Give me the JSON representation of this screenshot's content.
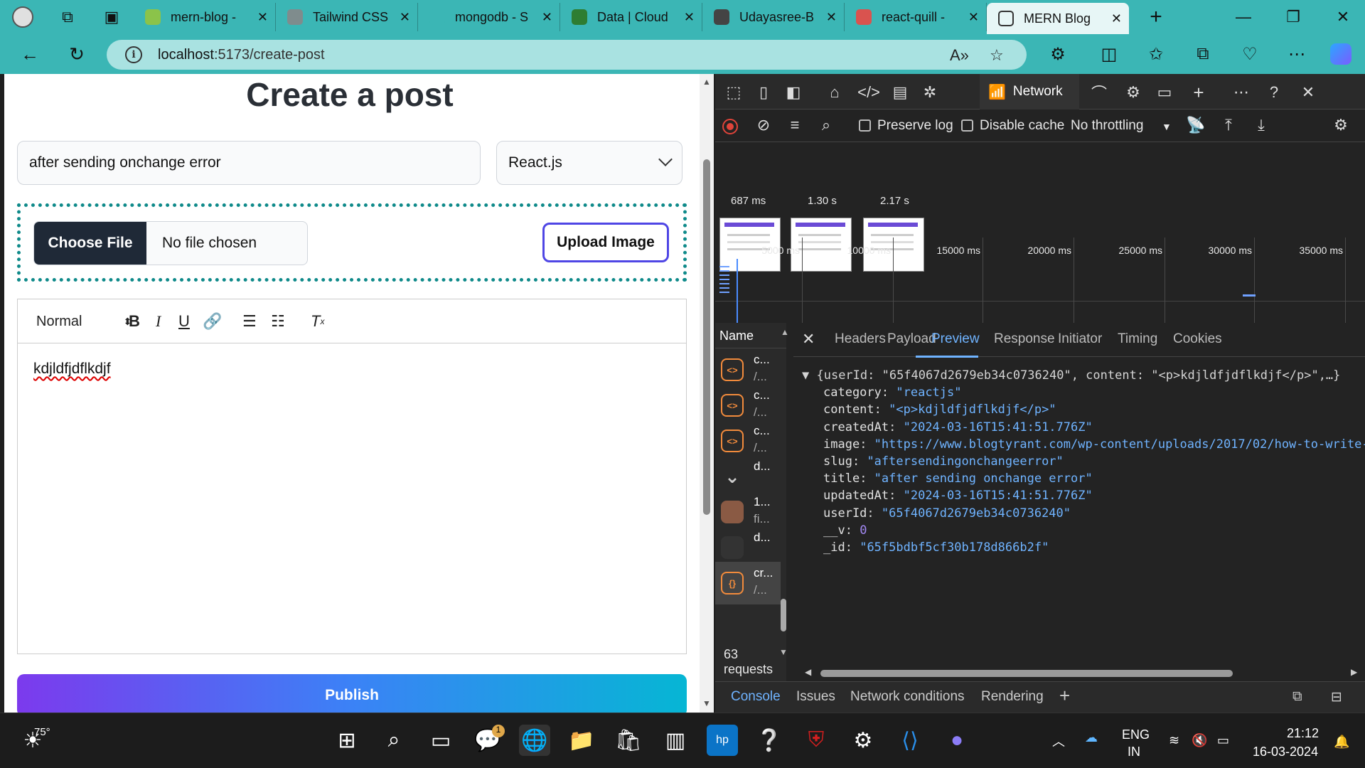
{
  "browser": {
    "tabs": [
      {
        "label": "mern-blog -",
        "color": "#8bc34a"
      },
      {
        "label": "Tailwind CSS",
        "color": "#7f8c8d"
      },
      {
        "label": "mongodb - S",
        "color": "#3bb6b5"
      },
      {
        "label": "Data | Cloud",
        "color": "#2e7d32"
      },
      {
        "label": "Udayasree-B",
        "color": "#444444"
      },
      {
        "label": "react-quill -",
        "color": "#d9534f"
      },
      {
        "label": "MERN Blog",
        "color": "#e7f6f6"
      }
    ],
    "url_host": "localhost",
    "url_path": ":5173/create-post"
  },
  "page": {
    "title": "Create a post",
    "title_input_value": "after sending onchange error",
    "category_value": "React.js",
    "choose_file_label": "Choose File",
    "no_file_label": "No file chosen",
    "upload_label": "Upload Image",
    "editor_header": "Normal",
    "editor_text": "kdjldfjdflkdjf",
    "publish_label": "Publish"
  },
  "devtools": {
    "network_tab": "Network",
    "preserve_log": "Preserve log",
    "disable_cache": "Disable cache",
    "throttling": "No throttling",
    "frame_times": [
      "687 ms",
      "1.30 s",
      "2.17 s"
    ],
    "timeline_ticks": [
      "5000 ms",
      "10000 ms",
      "15000 ms",
      "20000 ms",
      "25000 ms",
      "30000 ms",
      "35000 ms"
    ],
    "name_header": "Name",
    "requests": [
      {
        "name": "c...",
        "path": "/..."
      },
      {
        "name": "c...",
        "path": "/..."
      },
      {
        "name": "c...",
        "path": "/..."
      },
      {
        "name": "d...",
        "path": ""
      },
      {
        "name": "1...",
        "path": "fi..."
      },
      {
        "name": "d...",
        "path": ""
      },
      {
        "name": "cr...",
        "path": "/..."
      }
    ],
    "request_count": "63 requests",
    "panel_tabs": [
      "Headers",
      "Payload",
      "Preview",
      "Response",
      "Initiator",
      "Timing",
      "Cookies"
    ],
    "json_summary": "{userId: \"65f4067d2679eb34c0736240\", content: \"<p>kdjldfjdflkdjf</p>\",…}",
    "json_fields": [
      {
        "key": "category",
        "value": "\"reactjs\"",
        "type": "str"
      },
      {
        "key": "content",
        "value": "\"<p>kdjldfjdflkdjf</p>\"",
        "type": "str"
      },
      {
        "key": "createdAt",
        "value": "\"2024-03-16T15:41:51.776Z\"",
        "type": "str"
      },
      {
        "key": "image",
        "value": "\"https://www.blogtyrant.com/wp-content/uploads/2017/02/how-to-write-",
        "type": "str"
      },
      {
        "key": "slug",
        "value": "\"aftersendingonchangeerror\"",
        "type": "str"
      },
      {
        "key": "title",
        "value": "\"after sending onchange error\"",
        "type": "str"
      },
      {
        "key": "updatedAt",
        "value": "\"2024-03-16T15:41:51.776Z\"",
        "type": "str"
      },
      {
        "key": "userId",
        "value": "\"65f4067d2679eb34c0736240\"",
        "type": "str"
      },
      {
        "key": "__v",
        "value": "0",
        "type": "num"
      },
      {
        "key": "_id",
        "value": "\"65f5bdbf5cf30b178d866b2f\"",
        "type": "str"
      }
    ],
    "drawer_tabs": [
      "Console",
      "Issues",
      "Network conditions",
      "Rendering"
    ]
  },
  "taskbar": {
    "weather": "75°",
    "chat_badge": "1",
    "language_1": "ENG",
    "language_2": "IN",
    "time": "21:12",
    "date": "16-03-2024"
  }
}
